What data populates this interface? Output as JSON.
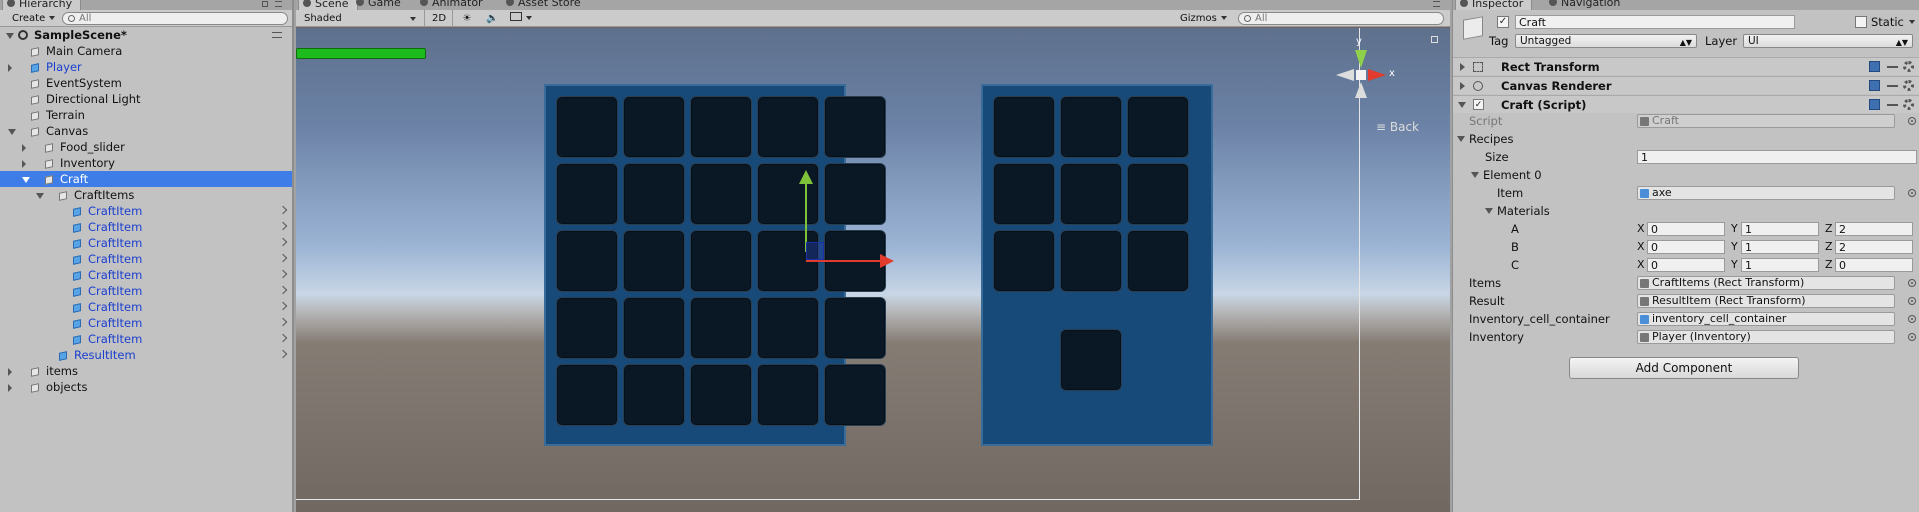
{
  "hierarchy": {
    "tab": "Hierarchy",
    "create": "Create",
    "search_placeholder": "All",
    "scene": "SampleScene*",
    "items": [
      {
        "label": "Main Camera",
        "indent": 0,
        "arrow": "none",
        "prefab": false
      },
      {
        "label": "Player",
        "indent": 0,
        "arrow": "right",
        "prefab": true
      },
      {
        "label": "EventSystem",
        "indent": 0,
        "arrow": "none",
        "prefab": false
      },
      {
        "label": "Directional Light",
        "indent": 0,
        "arrow": "none",
        "prefab": false
      },
      {
        "label": "Terrain",
        "indent": 0,
        "arrow": "none",
        "prefab": false
      },
      {
        "label": "Canvas",
        "indent": 0,
        "arrow": "down",
        "prefab": false
      },
      {
        "label": "Food_slider",
        "indent": 1,
        "arrow": "right",
        "prefab": false
      },
      {
        "label": "Inventory",
        "indent": 1,
        "arrow": "right",
        "prefab": false
      },
      {
        "label": "Craft",
        "indent": 1,
        "arrow": "down",
        "prefab": false,
        "selected": true
      },
      {
        "label": "CraftItems",
        "indent": 2,
        "arrow": "down",
        "prefab": false
      },
      {
        "label": "CraftItem",
        "indent": 3,
        "arrow": "none",
        "prefab": true,
        "chevron": true
      },
      {
        "label": "CraftItem",
        "indent": 3,
        "arrow": "none",
        "prefab": true,
        "chevron": true
      },
      {
        "label": "CraftItem",
        "indent": 3,
        "arrow": "none",
        "prefab": true,
        "chevron": true
      },
      {
        "label": "CraftItem",
        "indent": 3,
        "arrow": "none",
        "prefab": true,
        "chevron": true
      },
      {
        "label": "CraftItem",
        "indent": 3,
        "arrow": "none",
        "prefab": true,
        "chevron": true
      },
      {
        "label": "CraftItem",
        "indent": 3,
        "arrow": "none",
        "prefab": true,
        "chevron": true
      },
      {
        "label": "CraftItem",
        "indent": 3,
        "arrow": "none",
        "prefab": true,
        "chevron": true
      },
      {
        "label": "CraftItem",
        "indent": 3,
        "arrow": "none",
        "prefab": true,
        "chevron": true
      },
      {
        "label": "CraftItem",
        "indent": 3,
        "arrow": "none",
        "prefab": true,
        "chevron": true
      },
      {
        "label": "ResultItem",
        "indent": 2,
        "arrow": "none",
        "prefab": true,
        "chevron": true
      },
      {
        "label": "items",
        "indent": 0,
        "arrow": "right",
        "prefab": false
      },
      {
        "label": "objects",
        "indent": 0,
        "arrow": "right",
        "prefab": false
      }
    ]
  },
  "scene": {
    "tabs": [
      "Scene",
      "Game",
      "Animator",
      "Asset Store"
    ],
    "shading": "Shaded",
    "mode_2d": "2D",
    "gizmos": "Gizmos",
    "search_placeholder": "All",
    "back_label": "Back",
    "axis_y": "y",
    "axis_x": "x"
  },
  "inspector": {
    "tabs": [
      "Inspector",
      "Navigation"
    ],
    "object_name": "Craft",
    "static_label": "Static",
    "tag_label": "Tag",
    "tag_value": "Untagged",
    "layer_label": "Layer",
    "layer_value": "UI",
    "components": [
      "Rect Transform",
      "Canvas Renderer",
      "Craft (Script)"
    ],
    "script_label": "Script",
    "script_value": "Craft",
    "recipes_label": "Recipes",
    "size_label": "Size",
    "size_value": "1",
    "element0_label": "Element 0",
    "item_label": "Item",
    "item_value": "axe",
    "materials_label": "Materials",
    "materials": [
      {
        "name": "A",
        "x": "0",
        "y": "1",
        "z": "2"
      },
      {
        "name": "B",
        "x": "0",
        "y": "1",
        "z": "2"
      },
      {
        "name": "C",
        "x": "0",
        "y": "1",
        "z": "0"
      }
    ],
    "xyz_labels": [
      "X",
      "Y",
      "Z"
    ],
    "refs": [
      {
        "label": "Items",
        "value": "CraftItems (Rect Transform)"
      },
      {
        "label": "Result",
        "value": "ResultItem (Rect Transform)"
      },
      {
        "label": "Inventory_cell_container",
        "value": "inventory_cell_container"
      },
      {
        "label": "Inventory",
        "value": "Player (Inventory)"
      }
    ],
    "add_component": "Add Component"
  }
}
